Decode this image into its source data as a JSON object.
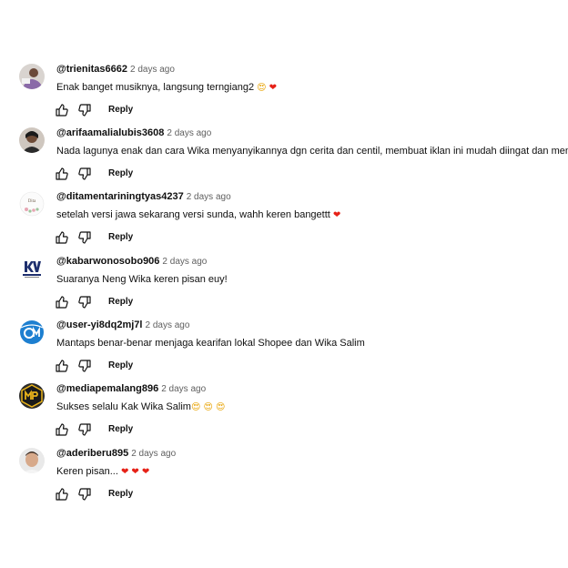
{
  "comments": [
    {
      "author": "@trienitas6662",
      "time": "2 days ago",
      "text": "Enak banget musiknya, langsung terngiang2",
      "emojis": [
        "smiling-face-with-heart-eyes",
        "red-heart"
      ],
      "avatar": "user-photo-avatar",
      "reply_label": "Reply"
    },
    {
      "author": "@arifaamalialubis3608",
      "time": "2 days ago",
      "text": "Nada lagunya enak dan cara Wika menyanyikannya dgn cerita dan centil, membuat iklan ini mudah diingat dan menarik",
      "emojis": [],
      "avatar": "user-photo-avatar",
      "reply_label": "Reply"
    },
    {
      "author": "@ditamentariningtyas4237",
      "time": "2 days ago",
      "text": "setelah versi jawa sekarang versi sunda, wahh keren bangettt",
      "emojis": [
        "red-heart"
      ],
      "avatar": "floral-logo-avatar",
      "reply_label": "Reply"
    },
    {
      "author": "@kabarwonosobo906",
      "time": "2 days ago",
      "text": "Suaranya Neng Wika keren pisan euy!",
      "emojis": [],
      "avatar": "kw-logo-avatar",
      "reply_label": "Reply"
    },
    {
      "author": "@user-yi8dq2mj7l",
      "time": "2 days ago",
      "text": "Mantaps benar-benar menjaga kearifan lokal Shopee dan Wika Salim",
      "emojis": [],
      "avatar": "om-logo-avatar",
      "reply_label": "Reply"
    },
    {
      "author": "@mediapemalang896",
      "time": "2 days ago",
      "text": "Sukses selalu Kak Wika Salim",
      "emojis": [
        "smiling-face-with-heart-eyes",
        "smiling-face-with-heart-eyes",
        "smiling-face-with-heart-eyes"
      ],
      "avatar": "mp-logo-avatar",
      "reply_label": "Reply"
    },
    {
      "author": "@aderiberu895",
      "time": "2 days ago",
      "text": "Keren pisan...",
      "emojis": [
        "red-heart",
        "red-heart",
        "red-heart"
      ],
      "avatar": "user-photo-avatar",
      "reply_label": "Reply"
    }
  ],
  "icons": {
    "like": "thumbs-up-icon",
    "dislike": "thumbs-down-icon"
  },
  "colors": {
    "author": "#0f0f0f",
    "timestamp": "#606060",
    "heart": "#e62117"
  }
}
